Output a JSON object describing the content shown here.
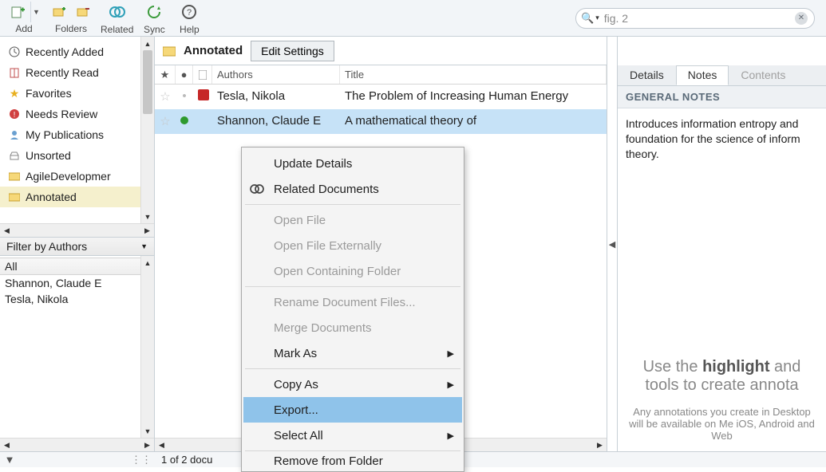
{
  "toolbar": {
    "add": "Add",
    "folders": "Folders",
    "related": "Related",
    "sync": "Sync",
    "help": "Help"
  },
  "search": {
    "value": "fig. 2"
  },
  "tree": [
    {
      "icon": "clock",
      "label": "Recently Added"
    },
    {
      "icon": "book",
      "label": "Recently Read"
    },
    {
      "icon": "star",
      "label": "Favorites"
    },
    {
      "icon": "excl",
      "label": "Needs Review"
    },
    {
      "icon": "user",
      "label": "My Publications"
    },
    {
      "icon": "tray",
      "label": "Unsorted"
    },
    {
      "icon": "fold",
      "label": "AgileDevelopmer"
    },
    {
      "icon": "fold",
      "label": "Annotated",
      "selected": true
    }
  ],
  "filter": {
    "title": "Filter by Authors",
    "items": [
      "All",
      "Shannon, Claude E",
      "Tesla, Nikola"
    ],
    "selected": 0
  },
  "main": {
    "folder": "Annotated",
    "edit": "Edit Settings",
    "cols": {
      "authors": "Authors",
      "title": "Title"
    },
    "rows": [
      {
        "dot": "",
        "doc": "pdf",
        "author": "Tesla, Nikola",
        "title": "The Problem of Increasing Human Energy"
      },
      {
        "dot": "green",
        "doc": "",
        "author": "Shannon, Claude E",
        "title": "A mathematical theory of",
        "selected": true
      }
    ]
  },
  "right": {
    "tabs": {
      "details": "Details",
      "notes": "Notes",
      "contents": "Contents"
    },
    "general_hdr": "GENERAL NOTES",
    "note": "Introduces information entropy and foundation for the science of inform theory.",
    "hint1a": "Use the ",
    "hint1b": "highlight",
    "hint1c": " and tools to create annota",
    "hint2": "Any annotations you create in Desktop will be available on Me iOS, Android and Web"
  },
  "context": [
    {
      "label": "Update Details"
    },
    {
      "label": "Related Documents",
      "icon": "related"
    },
    {
      "sep": true
    },
    {
      "label": "Open File",
      "disabled": true
    },
    {
      "label": "Open File Externally",
      "disabled": true
    },
    {
      "label": "Open Containing Folder",
      "disabled": true
    },
    {
      "sep": true
    },
    {
      "label": "Rename Document Files...",
      "disabled": true
    },
    {
      "label": "Merge Documents",
      "disabled": true
    },
    {
      "label": "Mark As",
      "submenu": true
    },
    {
      "sep": true
    },
    {
      "label": "Copy As",
      "submenu": true
    },
    {
      "label": "Export...",
      "highlight": true
    },
    {
      "label": "Select All",
      "submenu": true
    },
    {
      "sep": true
    },
    {
      "label": "Remove from Folder",
      "cut": true
    }
  ],
  "status": "1 of 2 docu"
}
